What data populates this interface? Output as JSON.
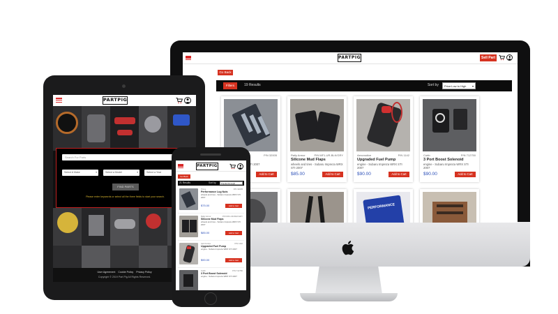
{
  "brand": {
    "logo_text": "PARTPIG",
    "accent": "#d63220",
    "price_color": "#2b4fb8"
  },
  "header": {
    "sell_label": "Sell Part"
  },
  "results": {
    "back_label": "Go Back",
    "filters_label": "Filters",
    "count_label": "19 Results",
    "sort_label": "Sort by",
    "sort_value": "Price:Low to High"
  },
  "products": [
    {
      "brand": "",
      "part_no": "P/N 32005",
      "name": "Lug Nuts",
      "desc": "- Subaru Impreza STI 2007",
      "price": "",
      "add": "Add to Cart"
    },
    {
      "brand": "Rally Armor",
      "part_no": "P/N MF1-UR-BLK/GRY",
      "name": "Silicone Mud Flaps",
      "desc": "wheels and tires - Subaru Impreza WRX STI 2007",
      "price": "$85.00",
      "add": "Add to Cart"
    },
    {
      "brand": "Aeromotive",
      "part_no": "P/N 1142",
      "name": "Upgraded Fuel Pump",
      "desc": "engine - Subaru Impreza WRX STI 2007",
      "price": "$90.00",
      "add": "Add to Cart"
    },
    {
      "brand": "Cobb",
      "part_no": "P/N 712750",
      "name": "3 Port Boost Solenoid",
      "desc": "engine - Subaru Impreza WRX STI 2007",
      "price": "$90.00",
      "add": "Add to Cart"
    }
  ],
  "tablet": {
    "search_placeholder": "Search For Parts",
    "select_make": "Select A Make",
    "select_model": "Select a Model",
    "select_year": "Select a Year",
    "find_label": "FIND PARTS",
    "note": "Please enter keywords or select all the three fields to start your search.",
    "footer_links": [
      "User Agreement",
      "Cookie Policy",
      "Privacy Policy"
    ],
    "copyright": "Copyright © 2019 Part Pig All Rights Reserved."
  },
  "phone": {
    "back_label": "Go Back",
    "count_label": "21 Results",
    "sort_label": "Sort by",
    "sort_value": "Popular Enough",
    "items": [
      {
        "brand": "Prime",
        "part_no": "P/N 32005",
        "name": "Performance Lug Nuts",
        "desc": "wheels and tires - Subaru Impreza WRX STI 2007",
        "price": "$75.00",
        "add": "Add to Cart"
      },
      {
        "brand": "Rally Armor",
        "part_no": "P/N MF1-UR-BLK/GRY",
        "name": "Silicone Mud Flaps",
        "desc": "wheels and tires - Subaru Impreza WRX STI 2007",
        "price": "$85.00",
        "add": "Add to Cart"
      },
      {
        "brand": "Aeromotive",
        "part_no": "P/N 1142",
        "name": "Upgraded Fuel Pump",
        "desc": "engine - Subaru Impreza WRX STI 2007",
        "price": "$90.00",
        "add": "Add to Cart"
      },
      {
        "brand": "Cobb",
        "part_no": "P/N 712750",
        "name": "3 Port Boost Solenoid",
        "desc": "engine - Subaru Impreza WRX STI 2007",
        "price": "",
        "add": ""
      }
    ]
  },
  "bottom_row": [
    {
      "label": ""
    },
    {
      "label": ""
    },
    {
      "label": "PERFORMANCE"
    },
    {
      "label": ""
    }
  ],
  "icons": [
    "hamburger-menu-icon",
    "cart-icon",
    "user-icon",
    "apple-logo-icon"
  ]
}
